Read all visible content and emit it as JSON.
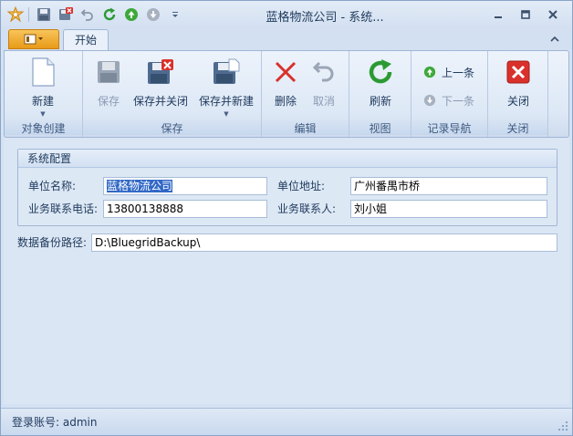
{
  "window": {
    "title": "蓝格物流公司 - 系统...",
    "controls": [
      "minimize",
      "restore",
      "close"
    ]
  },
  "quick_access": [
    {
      "name": "app-logo-icon"
    },
    {
      "name": "save-icon"
    },
    {
      "name": "save-close-icon"
    },
    {
      "name": "undo-icon"
    },
    {
      "name": "refresh-icon"
    },
    {
      "name": "prev-record-icon"
    },
    {
      "name": "next-record-icon"
    },
    {
      "name": "customize-dropdown-icon"
    }
  ],
  "tabs": {
    "home": "开始"
  },
  "ribbon": {
    "groups": {
      "create": "对象创建",
      "save": "保存",
      "edit": "编辑",
      "view": "视图",
      "nav": "记录导航",
      "close": "关闭"
    },
    "buttons": {
      "new": "新建",
      "save": "保存",
      "save_close": "保存并关闭",
      "save_new": "保存并新建",
      "delete": "删除",
      "cancel": "取消",
      "refresh": "刷新",
      "prev": "上一条",
      "next": "下一条",
      "close": "关闭"
    }
  },
  "form": {
    "section_title": "系统配置",
    "company_name_label": "单位名称:",
    "company_name_value": "蓝格物流公司",
    "address_label": "单位地址:",
    "address_value": "广州番禺市桥",
    "phone_label": "业务联系电话:",
    "phone_value": "13800138888",
    "contact_label": "业务联系人:",
    "contact_value": "刘小姐",
    "backup_label": "数据备份路径:",
    "backup_value": "D:\\BluegridBackup\\"
  },
  "status": {
    "login": "登录账号: admin"
  },
  "colors": {
    "accent_orange": "#e89a18",
    "ribbon_bg": "#dde8f6",
    "selection": "#3168c6"
  }
}
